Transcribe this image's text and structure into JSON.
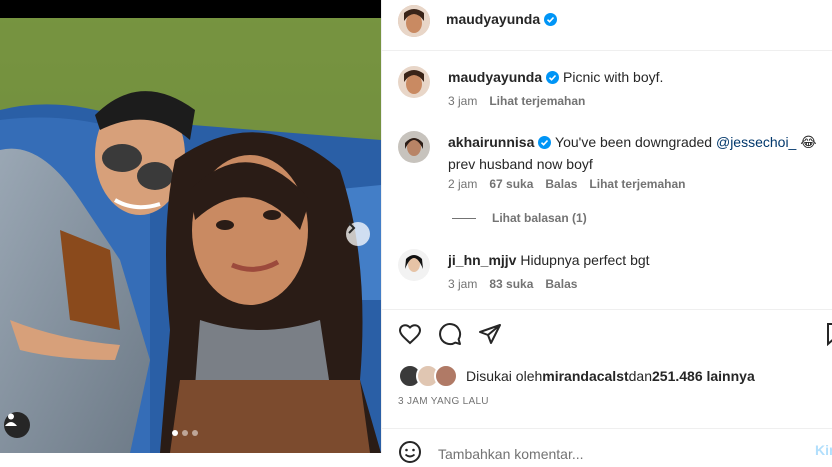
{
  "post": {
    "author": "maudyayunda",
    "caption_author": "maudyayunda",
    "caption": "Picnic with boyf.",
    "caption_time": "3 jam",
    "caption_translate": "Lihat terjemahan",
    "carousel_dots": 3,
    "carousel_active": 0
  },
  "comments": [
    {
      "user": "akhairunnisa",
      "verified": true,
      "text_before": "You've been downgraded ",
      "mention": "@jessechoi_",
      "emoji": "😂",
      "text_after": "prev husband now boyf",
      "time": "2 jam",
      "likes": "67 suka",
      "reply": "Balas",
      "translate": "Lihat terjemahan",
      "view_replies": "Lihat balasan (1)"
    },
    {
      "user": "ji_hn_mjjv",
      "verified": false,
      "text": "Hidupnya perfect bgt",
      "time": "3 jam",
      "likes": "83 suka",
      "reply": "Balas"
    }
  ],
  "likes": {
    "prefix": "Disukai oleh ",
    "user": "mirandacalst",
    "middle": " dan ",
    "count": "251.486 lainnya"
  },
  "timestamp": "3 JAM YANG LALU",
  "add_comment": {
    "placeholder": "Tambahkan komentar...",
    "post_label": "Kirim"
  },
  "icons": {
    "like": "heart-icon",
    "comment": "comment-icon",
    "share": "share-icon",
    "save": "bookmark-icon",
    "emoji": "emoji-icon",
    "verified": "verified-badge-icon",
    "tag": "user-tag-icon",
    "next": "chevron-right-icon"
  },
  "colors": {
    "verified": "#0095f6",
    "mention": "#00376b",
    "secondary_text": "#737373",
    "post_button": "#b2dffc"
  }
}
